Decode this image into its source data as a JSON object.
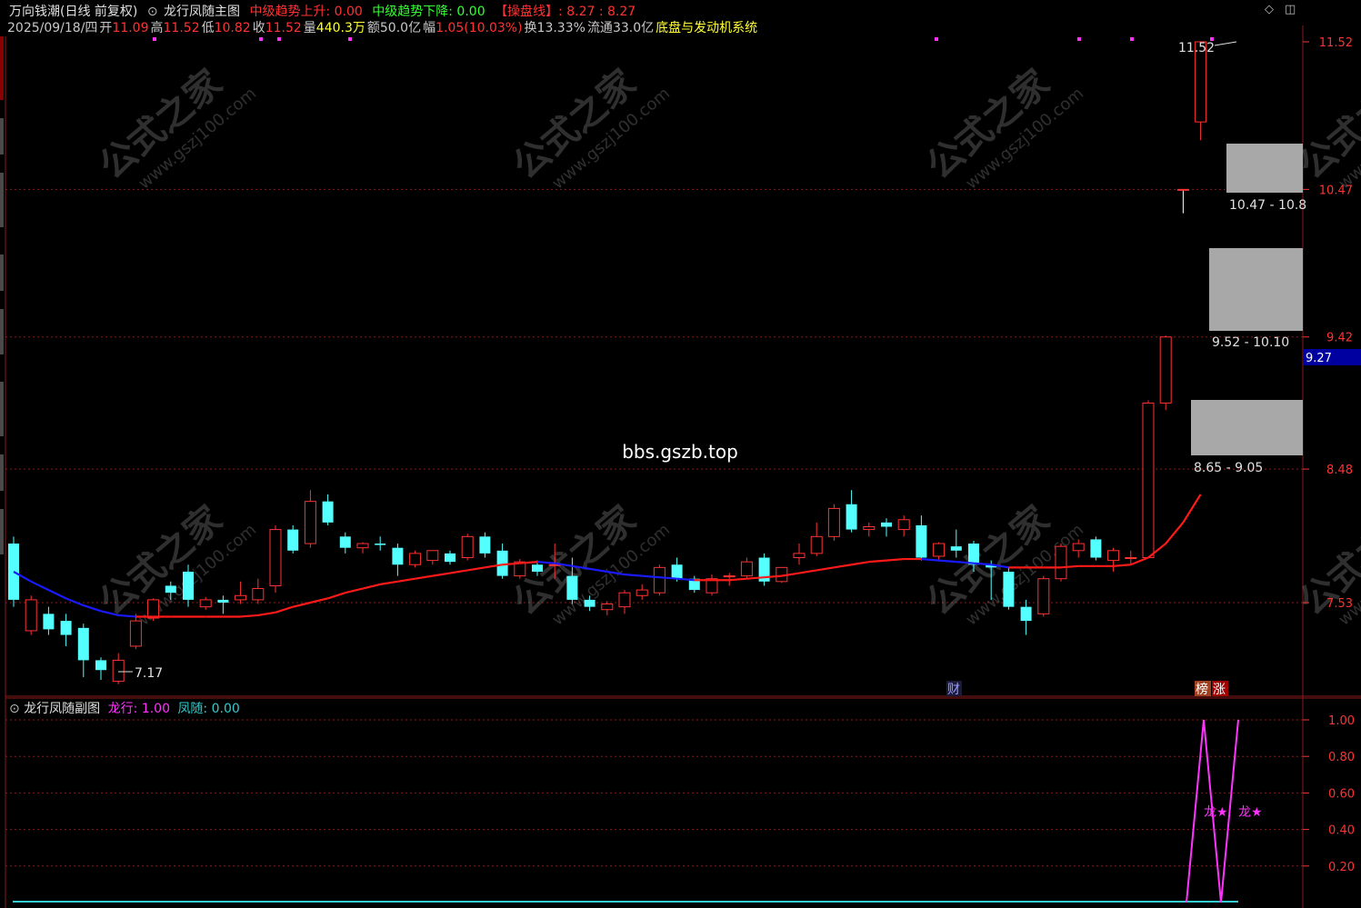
{
  "header": {
    "app_name": "万向钱潮(日线 前复权)",
    "main_indicator_name": "龙行凤随主图",
    "trend_up_label": "中级趋势上升: 0.00",
    "trend_down_label": "中级趋势下降: 0.00",
    "control_line_label": "【操盘线】: 8.27 : 8.27",
    "date": "2025/09/18/四",
    "open_label": "开",
    "open_value": "11.09",
    "high_label": "高",
    "high_value": "11.52",
    "low_label": "低",
    "low_value": "10.82",
    "close_label": "收",
    "close_value": "11.52",
    "volume_label": "量",
    "volume_value": "440.3万",
    "amount_label": "额",
    "amount_value": "50.0亿",
    "change_label": "幅",
    "change_value": "1.05(10.03%)",
    "turnover_label": "换",
    "turnover_value": "13.33%",
    "float_label": "流通",
    "float_value": "33.0亿",
    "system_name": "底盘与发动机系统"
  },
  "main_chart": {
    "price_axis": [
      "11.52",
      "10.47",
      "9.42",
      "8.48",
      "7.53"
    ],
    "current_price_tag": "9.27",
    "high_marker": "11.52",
    "low_marker": "7.17",
    "box_labels": [
      "10.47 - 10.8",
      "9.52 - 10.10",
      "8.65 - 9.05"
    ],
    "watermark_text": "bbs.gszb.top",
    "logo_text": "公式之家",
    "logo_url_text": "www.gszj100.com",
    "badge_cai": "财",
    "badge_bang": "榜",
    "badge_zhang": "涨"
  },
  "sub_chart": {
    "title": "龙行凤随副图",
    "long_label": "龙行: 1.00",
    "feng_label": "凤随: 0.00",
    "axis": [
      "1.00",
      "0.80",
      "0.60",
      "0.40",
      "0.20"
    ],
    "star_label_1": "龙★",
    "star_label_2": "龙★"
  },
  "colors": {
    "up": "#ff3232",
    "down": "#54ffff",
    "ma_up": "#ff1a1a",
    "ma_down": "#1a1aff",
    "magenta": "#ff33ff",
    "cyan": "#33cccc",
    "box": "#a8a8a8",
    "grid": "#8b1a1a",
    "tag_bg": "#0000a0"
  },
  "chart_data": {
    "type": "candlestick",
    "price_range": [
      6.9,
      11.8
    ],
    "candles": [
      {
        "o": 7.95,
        "c": 7.55,
        "h": 8.0,
        "l": 7.5
      },
      {
        "o": 7.33,
        "c": 7.55,
        "h": 7.58,
        "l": 7.3
      },
      {
        "o": 7.45,
        "c": 7.34,
        "h": 7.5,
        "l": 7.3
      },
      {
        "o": 7.4,
        "c": 7.3,
        "h": 7.45,
        "l": 7.22
      },
      {
        "o": 7.35,
        "c": 7.12,
        "h": 7.38,
        "l": 7.0
      },
      {
        "o": 7.12,
        "c": 7.05,
        "h": 7.14,
        "l": 6.98
      },
      {
        "o": 6.97,
        "c": 7.12,
        "h": 7.17,
        "l": 6.95
      },
      {
        "o": 7.22,
        "c": 7.4,
        "h": 7.45,
        "l": 7.2
      },
      {
        "o": 7.42,
        "c": 7.55,
        "h": 7.56,
        "l": 7.4
      },
      {
        "o": 7.65,
        "c": 7.6,
        "h": 7.68,
        "l": 7.55
      },
      {
        "o": 7.75,
        "c": 7.55,
        "h": 7.8,
        "l": 7.5
      },
      {
        "o": 7.5,
        "c": 7.55,
        "h": 7.57,
        "l": 7.48
      },
      {
        "o": 7.55,
        "c": 7.53,
        "h": 7.58,
        "l": 7.45
      },
      {
        "o": 7.55,
        "c": 7.58,
        "h": 7.68,
        "l": 7.52
      },
      {
        "o": 7.55,
        "c": 7.63,
        "h": 7.7,
        "l": 7.52
      },
      {
        "o": 7.65,
        "c": 8.05,
        "h": 8.08,
        "l": 7.6
      },
      {
        "o": 8.05,
        "c": 7.9,
        "h": 8.08,
        "l": 7.88
      },
      {
        "o": 7.95,
        "c": 8.25,
        "h": 8.33,
        "l": 7.92
      },
      {
        "o": 8.25,
        "c": 8.1,
        "h": 8.3,
        "l": 8.08
      },
      {
        "o": 8.0,
        "c": 7.92,
        "h": 8.03,
        "l": 7.88
      },
      {
        "o": 7.92,
        "c": 7.95,
        "h": 7.96,
        "l": 7.88
      },
      {
        "o": 7.95,
        "c": 7.94,
        "h": 8.0,
        "l": 7.9
      },
      {
        "o": 7.92,
        "c": 7.8,
        "h": 7.95,
        "l": 7.72
      },
      {
        "o": 7.8,
        "c": 7.88,
        "h": 7.9,
        "l": 7.78
      },
      {
        "o": 7.83,
        "c": 7.9,
        "h": 7.9,
        "l": 7.8
      },
      {
        "o": 7.88,
        "c": 7.82,
        "h": 7.9,
        "l": 7.8
      },
      {
        "o": 7.85,
        "c": 8.0,
        "h": 8.02,
        "l": 7.83
      },
      {
        "o": 8.0,
        "c": 7.88,
        "h": 8.03,
        "l": 7.85
      },
      {
        "o": 7.9,
        "c": 7.72,
        "h": 7.95,
        "l": 7.7
      },
      {
        "o": 7.72,
        "c": 7.82,
        "h": 7.84,
        "l": 7.7
      },
      {
        "o": 7.8,
        "c": 7.75,
        "h": 7.83,
        "l": 7.72
      },
      {
        "o": 7.8,
        "c": 7.8,
        "h": 7.95,
        "l": 7.7
      },
      {
        "o": 7.72,
        "c": 7.55,
        "h": 7.85,
        "l": 7.52
      },
      {
        "o": 7.55,
        "c": 7.5,
        "h": 7.58,
        "l": 7.47
      },
      {
        "o": 7.48,
        "c": 7.52,
        "h": 7.54,
        "l": 7.44
      },
      {
        "o": 7.5,
        "c": 7.6,
        "h": 7.62,
        "l": 7.45
      },
      {
        "o": 7.58,
        "c": 7.62,
        "h": 7.66,
        "l": 7.55
      },
      {
        "o": 7.6,
        "c": 7.78,
        "h": 7.8,
        "l": 7.58
      },
      {
        "o": 7.8,
        "c": 7.7,
        "h": 7.85,
        "l": 7.68
      },
      {
        "o": 7.7,
        "c": 7.62,
        "h": 7.72,
        "l": 7.6
      },
      {
        "o": 7.6,
        "c": 7.7,
        "h": 7.73,
        "l": 7.58
      },
      {
        "o": 7.72,
        "c": 7.72,
        "h": 7.74,
        "l": 7.65
      },
      {
        "o": 7.72,
        "c": 7.82,
        "h": 7.85,
        "l": 7.7
      },
      {
        "o": 7.85,
        "c": 7.68,
        "h": 7.88,
        "l": 7.65
      },
      {
        "o": 7.68,
        "c": 7.78,
        "h": 7.78,
        "l": 7.67
      },
      {
        "o": 7.85,
        "c": 7.88,
        "h": 7.95,
        "l": 7.8
      },
      {
        "o": 7.88,
        "c": 8.0,
        "h": 8.1,
        "l": 7.86
      },
      {
        "o": 8.0,
        "c": 8.2,
        "h": 8.23,
        "l": 7.97
      },
      {
        "o": 8.23,
        "c": 8.05,
        "h": 8.33,
        "l": 8.03
      },
      {
        "o": 8.05,
        "c": 8.07,
        "h": 8.1,
        "l": 8.0
      },
      {
        "o": 8.1,
        "c": 8.07,
        "h": 8.13,
        "l": 8.0
      },
      {
        "o": 8.05,
        "c": 8.12,
        "h": 8.15,
        "l": 8.0
      },
      {
        "o": 8.08,
        "c": 7.85,
        "h": 8.15,
        "l": 7.83
      },
      {
        "o": 7.86,
        "c": 7.95,
        "h": 7.96,
        "l": 7.83
      },
      {
        "o": 7.93,
        "c": 7.9,
        "h": 8.05,
        "l": 7.85
      },
      {
        "o": 7.95,
        "c": 7.8,
        "h": 7.97,
        "l": 7.75
      },
      {
        "o": 7.8,
        "c": 7.78,
        "h": 7.83,
        "l": 7.55
      },
      {
        "o": 7.75,
        "c": 7.5,
        "h": 7.78,
        "l": 7.48
      },
      {
        "o": 7.5,
        "c": 7.4,
        "h": 7.55,
        "l": 7.3
      },
      {
        "o": 7.45,
        "c": 7.7,
        "h": 7.72,
        "l": 7.43
      },
      {
        "o": 7.7,
        "c": 7.93,
        "h": 7.95,
        "l": 7.68
      },
      {
        "o": 7.9,
        "c": 7.95,
        "h": 7.98,
        "l": 7.85
      },
      {
        "o": 7.98,
        "c": 7.85,
        "h": 8.0,
        "l": 7.83
      },
      {
        "o": 7.83,
        "c": 7.9,
        "h": 7.92,
        "l": 7.75
      },
      {
        "o": 7.85,
        "c": 7.85,
        "h": 7.9,
        "l": 7.8
      },
      {
        "o": 7.85,
        "c": 8.95,
        "h": 8.97,
        "l": 7.85
      },
      {
        "o": 8.95,
        "c": 9.42,
        "h": 9.43,
        "l": 8.9
      },
      {
        "o": 10.47,
        "c": 10.47,
        "h": 10.47,
        "l": 10.3
      },
      {
        "o": 10.95,
        "c": 11.52,
        "h": 11.52,
        "l": 10.82
      }
    ]
  },
  "sub_chart_data": {
    "type": "line",
    "range": [
      0,
      1.0
    ],
    "long_series_tail": [
      0.0,
      1.0,
      0.0,
      1.0
    ],
    "feng_series": 0.0
  }
}
